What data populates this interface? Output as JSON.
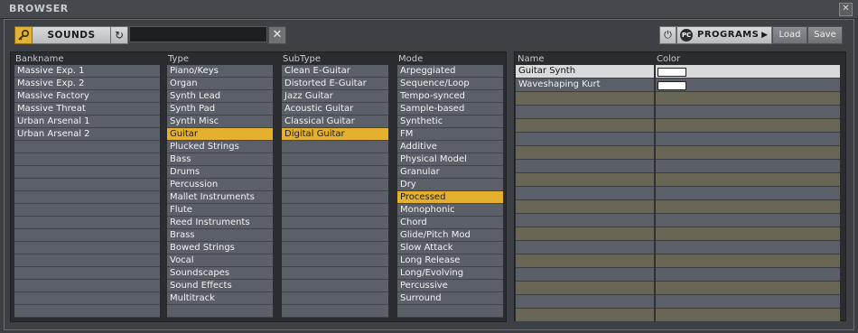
{
  "window": {
    "title": "BROWSER",
    "close_glyph": "✕"
  },
  "toolbar": {
    "search_icon": "key-icon",
    "sounds_label": "SOUNDS",
    "reset_glyph": "↻",
    "search_value": "",
    "clear_glyph": "✕",
    "power_glyph": "⏻",
    "pc_badge": "PC",
    "programs_label": "PROGRAMS",
    "programs_arrow": "▶",
    "load_label": "Load",
    "save_label": "Save"
  },
  "columns": {
    "bankname": {
      "header": "Bankname",
      "items": [
        "Massive Exp. 1",
        "Massive Exp. 2",
        "Massive Factory",
        "Massive Threat",
        "Urban Arsenal 1",
        "Urban Arsenal 2"
      ]
    },
    "type": {
      "header": "Type",
      "items": [
        "Piano/Keys",
        "Organ",
        "Synth Lead",
        "Synth Pad",
        "Synth Misc",
        "Guitar",
        "Plucked Strings",
        "Bass",
        "Drums",
        "Percussion",
        "Mallet Instruments",
        "Flute",
        "Reed Instruments",
        "Brass",
        "Bowed Strings",
        "Vocal",
        "Soundscapes",
        "Sound Effects",
        "Multitrack"
      ],
      "selected": 5
    },
    "subtype": {
      "header": "SubType",
      "items": [
        "Clean E-Guitar",
        "Distorted E-Guitar",
        "Jazz Guitar",
        "Acoustic Guitar",
        "Classical Guitar",
        "Digital Guitar"
      ],
      "selected": 5
    },
    "mode": {
      "header": "Mode",
      "items": [
        "Arpeggiated",
        "Sequence/Loop",
        "Tempo-synced",
        "Sample-based",
        "Synthetic",
        "FM",
        "Additive",
        "Physical Model",
        "Granular",
        "Dry",
        "Processed",
        "Monophonic",
        "Chord",
        "Glide/Pitch Mod",
        "Slow Attack",
        "Long Release",
        "Long/Evolving",
        "Percussive",
        "Surround"
      ],
      "selected": 10
    }
  },
  "programs": {
    "name_header": "Name",
    "color_header": "Color",
    "rows": [
      {
        "name": "Guitar Synth",
        "color": "#ffffff"
      },
      {
        "name": "Waveshaping Kurt",
        "color": "#ffffff"
      }
    ]
  },
  "colors": {
    "accent": "#e6b02f",
    "row": "#5a5f68",
    "row_alt": "#6a6656"
  }
}
